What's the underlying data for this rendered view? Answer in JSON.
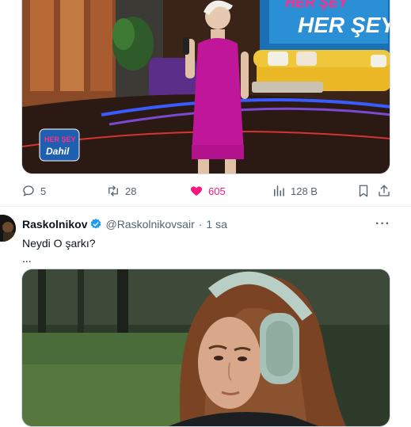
{
  "tweet1": {
    "media_caption": "HER ŞEY Dahil",
    "media_badge": "HER ŞEY Dahil",
    "actions": {
      "replies": "5",
      "reposts": "28",
      "likes": "605",
      "views": "128 B",
      "liked": true
    }
  },
  "tweet2": {
    "display_name": "Raskolnikov",
    "handle": "@Raskolnikovsair",
    "separator": "·",
    "time": "1 sa",
    "text_line1": "Neydi O şarkı?",
    "text_line2": "...",
    "more_label": "···"
  },
  "colors": {
    "like_active": "#f91880",
    "verified": "#1d9bf0",
    "secondary_text": "#536471"
  }
}
